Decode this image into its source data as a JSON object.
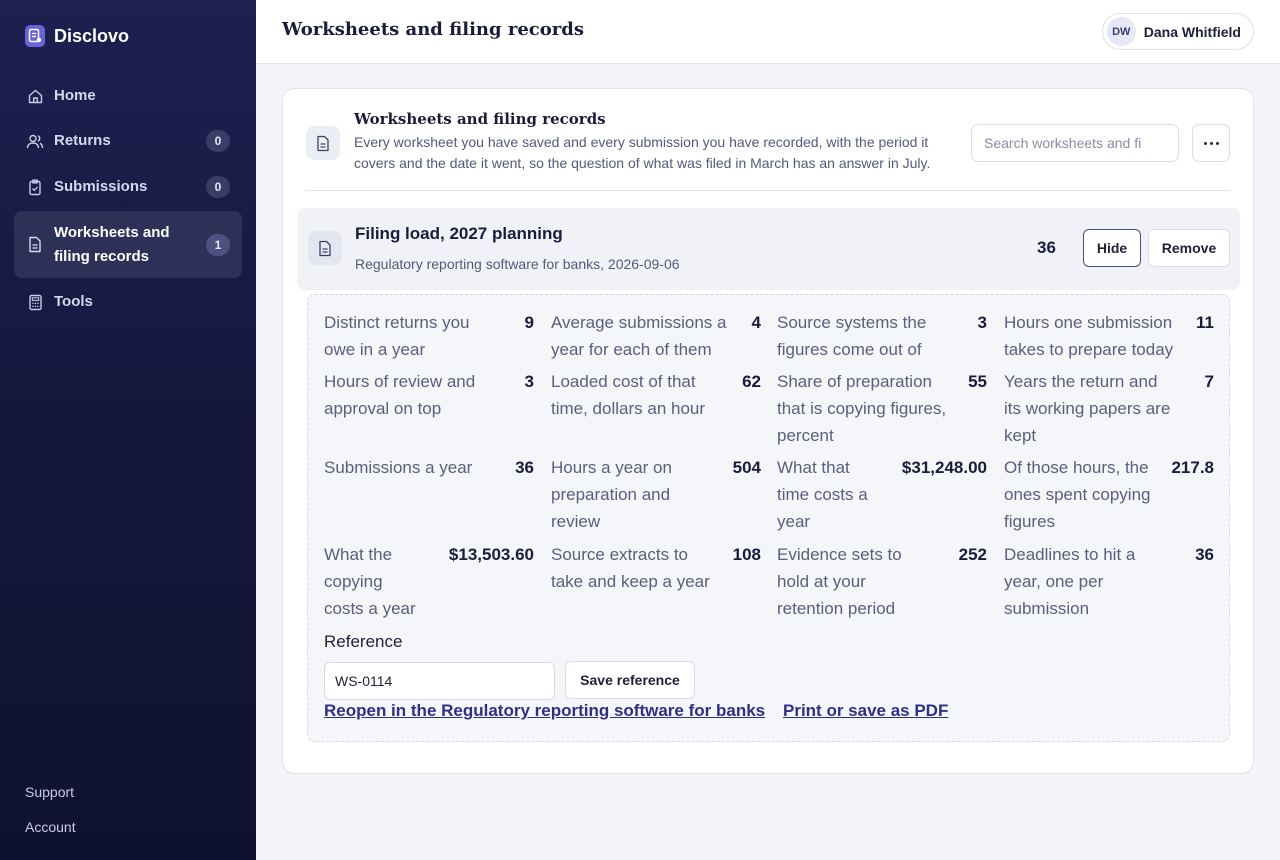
{
  "app": {
    "name": "Disclovo"
  },
  "sidebar": {
    "items": [
      {
        "label": "Home",
        "icon": "home-icon"
      },
      {
        "label": "Returns",
        "icon": "users-icon",
        "badge": "0"
      },
      {
        "label": "Submissions",
        "icon": "clipboard-icon",
        "badge": "0"
      },
      {
        "label": "Worksheets and filing records",
        "icon": "document-icon",
        "badge": "1",
        "active": true
      },
      {
        "label": "Tools",
        "icon": "calculator-icon"
      }
    ],
    "footer": {
      "support": "Support",
      "account": "Account"
    }
  },
  "header": {
    "title": "Worksheets and filing records",
    "user": {
      "initials": "DW",
      "name": "Dana Whitfield"
    }
  },
  "card": {
    "title": "Worksheets and filing records",
    "description": "Every worksheet you have saved and every submission you have recorded, with the period it covers and the date it went, so the question of what was filed in March has an answer in July.",
    "search_placeholder": "Search worksheets and fi"
  },
  "record": {
    "title": "Filing load, 2027 planning",
    "subtitle": "Regulatory reporting software for banks, 2026-09-06",
    "count": "36",
    "hide_label": "Hide",
    "remove_label": "Remove",
    "metrics": [
      {
        "label": "Distinct returns you owe in a year",
        "value": "9"
      },
      {
        "label": "Average submissions a year for each of them",
        "value": "4"
      },
      {
        "label": "Source systems the figures come out of",
        "value": "3"
      },
      {
        "label": "Hours one submission takes to prepare today",
        "value": "11"
      },
      {
        "label": "Hours of review and approval on top",
        "value": "3"
      },
      {
        "label": "Loaded cost of that time, dollars an hour",
        "value": "62"
      },
      {
        "label": "Share of preparation that is copying figures, percent",
        "value": "55"
      },
      {
        "label": "Years the return and its working papers are kept",
        "value": "7"
      },
      {
        "label": "Submissions a year",
        "value": "36"
      },
      {
        "label": "Hours a year on preparation and review",
        "value": "504"
      },
      {
        "label": "What that time costs a year",
        "value": "$31,248.00"
      },
      {
        "label": "Of those hours, the ones spent copying figures",
        "value": "217.8"
      },
      {
        "label": "What the copying costs a year",
        "value": "$13,503.60"
      },
      {
        "label": "Source extracts to take and keep a year",
        "value": "108"
      },
      {
        "label": "Evidence sets to hold at your retention period",
        "value": "252"
      },
      {
        "label": "Deadlines to hit a year, one per submission",
        "value": "36"
      }
    ],
    "reference_label": "Reference",
    "reference_value": "WS-0114",
    "save_reference_label": "Save reference",
    "reopen_link": "Reopen in the Regulatory reporting software for banks",
    "print_link": "Print or save as PDF"
  },
  "colors": {
    "sidebar_bg": "#1d2150",
    "accent": "#4a4d86",
    "link": "#2e2f8a"
  }
}
